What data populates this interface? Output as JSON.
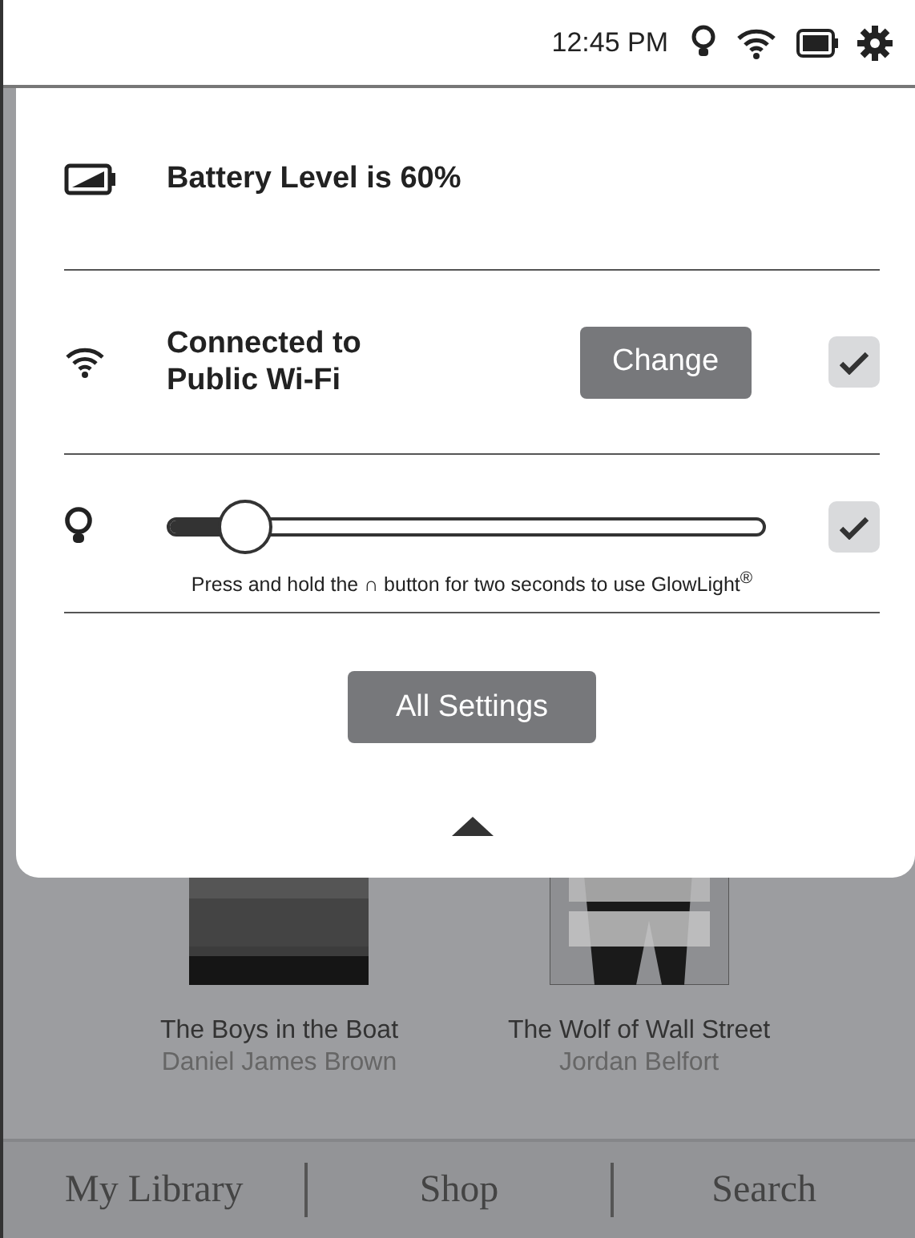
{
  "status_bar": {
    "time": "12:45 PM"
  },
  "quick_settings": {
    "battery": {
      "label": "Battery Level is 60%"
    },
    "wifi": {
      "label": "Connected to Public Wi-Fi",
      "button": "Change",
      "checked": true
    },
    "light": {
      "level": 0.13,
      "checked": true,
      "hint": "Press and hold the ∩ button for two seconds to use GlowLight$^{®}$"
    },
    "all_settings": "All Settings"
  },
  "books": [
    {
      "title": "The Boys in the Boat",
      "author": "Daniel James Brown",
      "kind": "picture"
    },
    {
      "title": "The Wolf of Wall Street",
      "author": "Jordan Belfort",
      "kind": "picture"
    }
  ],
  "nav": [
    {
      "label": "My Library"
    },
    {
      "label": "Shop"
    },
    {
      "label": "Search"
    }
  ]
}
